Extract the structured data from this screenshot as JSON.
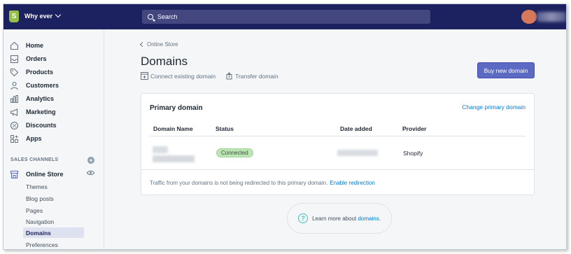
{
  "topbar": {
    "store_name": "Why ever",
    "search_placeholder": "Search"
  },
  "sidebar": {
    "items": [
      {
        "label": "Home",
        "icon": "home-icon"
      },
      {
        "label": "Orders",
        "icon": "orders-icon"
      },
      {
        "label": "Products",
        "icon": "tag-icon"
      },
      {
        "label": "Customers",
        "icon": "person-icon"
      },
      {
        "label": "Analytics",
        "icon": "bar-chart-icon"
      },
      {
        "label": "Marketing",
        "icon": "megaphone-icon"
      },
      {
        "label": "Discounts",
        "icon": "discount-icon"
      },
      {
        "label": "Apps",
        "icon": "apps-icon"
      }
    ],
    "sales_channels_title": "SALES CHANNELS",
    "online_store_label": "Online Store",
    "sub_items": [
      "Themes",
      "Blog posts",
      "Pages",
      "Navigation",
      "Domains",
      "Preferences"
    ],
    "active_sub_item": "Domains"
  },
  "main": {
    "breadcrumb": "Online Store",
    "title": "Domains",
    "connect_label": "Connect existing domain",
    "transfer_label": "Transfer domain",
    "buy_button": "Buy new domain",
    "card": {
      "title": "Primary domain",
      "change_link": "Change primary domain",
      "columns": [
        "Domain Name",
        "Status",
        "Date added",
        "Provider"
      ],
      "row": {
        "status": "Connected",
        "provider": "Shopify"
      },
      "footer_text": "Traffic from your domains is not being redirected to this primary domain.",
      "footer_link": "Enable redirection"
    },
    "learn_more_text": "Learn more about",
    "learn_more_link": "domains",
    "learn_more_suffix": "."
  },
  "colors": {
    "topbar": "#1c2260",
    "primary_button": "#5c6ac4",
    "link": "#007ace",
    "success_badge": "#bbe5b3"
  }
}
